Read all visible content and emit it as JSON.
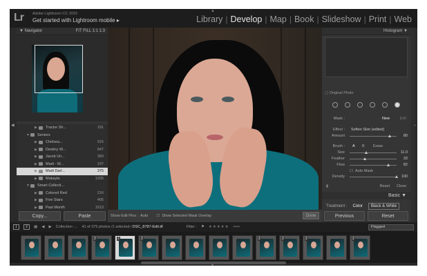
{
  "identity": {
    "logo": "Lr",
    "app_title": "Adobe Lightroom CC 2015",
    "mobile_link": "Get started with Lightroom mobile",
    "mobile_arrow": "▸"
  },
  "modules": {
    "library": "Library",
    "develop": "Develop",
    "map": "Map",
    "book": "Book",
    "slideshow": "Slideshow",
    "print": "Print",
    "web": "Web",
    "separator": "|"
  },
  "navigator": {
    "title": "Navigator",
    "zoom_options": "FIT  FILL  1:1  1:3"
  },
  "collections": [
    {
      "label": "Tractor Sh...",
      "count": "181",
      "level": 2
    },
    {
      "label": "Seniors",
      "count": "",
      "level": 1
    },
    {
      "label": "Chelsea...",
      "count": "915",
      "level": 2
    },
    {
      "label": "Destiny W...",
      "count": "847",
      "level": 2
    },
    {
      "label": "Jacob Un...",
      "count": "360",
      "level": 2
    },
    {
      "label": "Madi - W...",
      "count": "197",
      "level": 2
    },
    {
      "label": "Madi Darl...",
      "count": "375",
      "level": 2,
      "selected": true
    },
    {
      "label": "Makayla",
      "count": "1305",
      "level": 2
    },
    {
      "label": "Smart Collecti...",
      "count": "",
      "level": 1
    },
    {
      "label": "Colored Red",
      "count": "216",
      "level": 2
    },
    {
      "label": "Five Stars",
      "count": "405",
      "level": 2
    },
    {
      "label": "Past Month",
      "count": "1513",
      "level": 2
    }
  ],
  "left_buttons": {
    "copy": "Copy...",
    "paste": "Paste"
  },
  "toolbar": {
    "edit_pins_label": "Show Edit Pins :",
    "edit_pins_value": "Auto",
    "mask_overlay": "Show Selected Mask Overlay",
    "done": "Done"
  },
  "histogram": {
    "title": "Histogram",
    "original_photo": "Original Photo"
  },
  "mask": {
    "label": "Mask :",
    "new": "New",
    "edit": "Edit"
  },
  "effect": {
    "label": "Effect :",
    "preset": "Soften Skin (edited)",
    "amount_label": "Amount",
    "amount_value": "80",
    "amount_fraction": 0.85
  },
  "brush": {
    "label": "Brush :",
    "a": "A",
    "b": "B",
    "erase": "Erase",
    "rows": [
      {
        "label": "Size",
        "value": "11.0",
        "fraction": 0.35
      },
      {
        "label": "Feather",
        "value": "33",
        "fraction": 0.33
      },
      {
        "label": "Flow",
        "value": "82",
        "fraction": 0.82
      }
    ],
    "auto_mask": "Auto Mask",
    "density_label": "Density",
    "density_value": "100",
    "density_fraction": 1.0
  },
  "reset_close": {
    "reset": "Reset",
    "close": "Close"
  },
  "basic": {
    "title": "Basic",
    "treatment_label": "Treatment :",
    "color": "Color",
    "bw": "Black & White"
  },
  "right_buttons": {
    "previous": "Previous",
    "reset": "Reset"
  },
  "filmstrip_bar": {
    "page1": "1",
    "page2": "2",
    "collection": "Collection :...",
    "info": "41 of 375 photos /1 selected /",
    "filename": "DSC_8787-Edit.tif",
    "filter_label": "Filter :",
    "flagged": "Flagged"
  },
  "filmstrip": {
    "count": 15,
    "selected_index": 4,
    "badges": [
      "",
      "",
      "",
      "2",
      "2",
      "2",
      "",
      "",
      "",
      "",
      "2",
      "2",
      "2",
      "",
      "2"
    ]
  },
  "colors": {
    "background": "#2a2a2a",
    "panel": "#353535",
    "shirt": "#0e6f7c",
    "skin": "#dba895"
  }
}
